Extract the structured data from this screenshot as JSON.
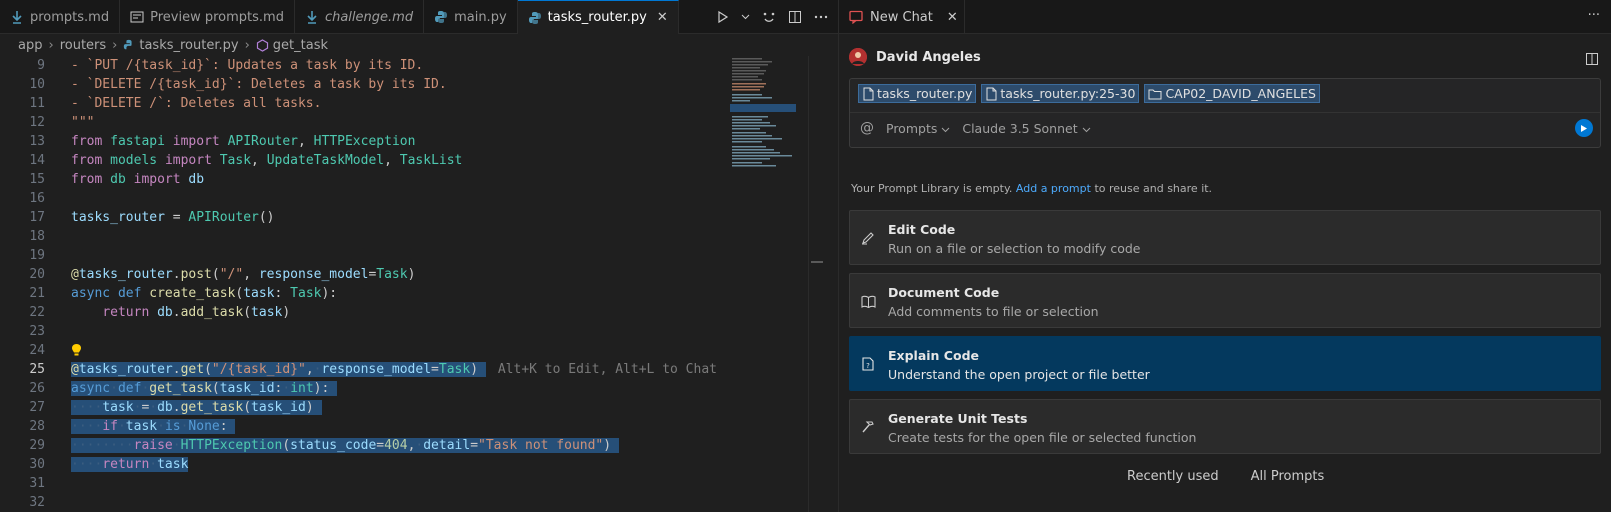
{
  "editor": {
    "tabs": [
      {
        "label": "prompts.md",
        "icon": "download-arrow-icon",
        "italic": false,
        "active": false
      },
      {
        "label": "Preview prompts.md",
        "icon": "preview-icon",
        "italic": false,
        "active": false
      },
      {
        "label": "challenge.md",
        "icon": "download-arrow-icon",
        "italic": true,
        "active": false
      },
      {
        "label": "main.py",
        "icon": "python-icon",
        "italic": false,
        "active": false
      },
      {
        "label": "tasks_router.py",
        "icon": "python-icon",
        "italic": false,
        "active": true
      }
    ],
    "close_glyph": "✕",
    "breadcrumb": [
      "app",
      "routers",
      "tasks_router.py",
      "get_task"
    ],
    "inline_hint": "Alt+K to Edit, Alt+L to Chat",
    "current_line": 25,
    "line_numbers": [
      "9",
      "10",
      "11",
      "12",
      "13",
      "14",
      "15",
      "16",
      "17",
      "18",
      "19",
      "20",
      "21",
      "22",
      "23",
      "24",
      "25",
      "26",
      "27",
      "28",
      "29",
      "30",
      "31",
      "32"
    ]
  },
  "chat": {
    "tab_label": "New Chat",
    "close_glyph": "✕",
    "more_glyph": "···",
    "user_name": "David Angeles",
    "context_chips": [
      "tasks_router.py",
      "tasks_router.py:25-30",
      "CAP02_DAVID_ANGELES"
    ],
    "mention_glyph": "@",
    "prompts_dropdown": "Prompts",
    "model_dropdown": "Claude 3.5 Sonnet",
    "library_msg_prefix": "Your Prompt Library is empty.",
    "library_msg_link": "Add a prompt",
    "library_msg_suffix": "to reuse and share it.",
    "cards": [
      {
        "title": "Edit Code",
        "desc": "Run on a file or selection to modify code",
        "icon": "pencil-icon"
      },
      {
        "title": "Document Code",
        "desc": "Add comments to file or selection",
        "icon": "book-icon"
      },
      {
        "title": "Explain Code",
        "desc": "Understand the open project or file better",
        "icon": "question-file-icon"
      },
      {
        "title": "Generate Unit Tests",
        "desc": "Create tests for the open file or selected function",
        "icon": "hammer-icon"
      }
    ],
    "bottom_tabs": [
      "Recently used",
      "All Prompts"
    ]
  },
  "colors": {
    "accent": "#0078d4",
    "selection": "#264f78",
    "active_card": "#04395e",
    "link": "#4daafc"
  }
}
